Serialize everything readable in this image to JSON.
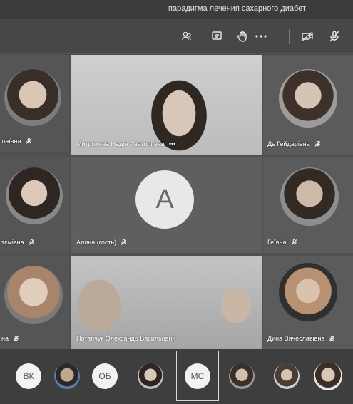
{
  "meeting": {
    "title": "парадигма лечения сахарного диабет"
  },
  "toolbar": {
    "icons": [
      "participants-icon",
      "chat-icon",
      "raise-hand-icon",
      "more-icon",
      "camera-off-icon",
      "mic-off-icon"
    ]
  },
  "participants": {
    "tiles": [
      {
        "label": "лаївна"
      },
      {
        "label": "Митрохина Надія Анатоліївна"
      },
      {
        "label": "Дь Гейдарівна"
      },
      {
        "label": "тємівна"
      },
      {
        "label": "Алина (гость)",
        "initial": "A"
      },
      {
        "label": "Геївна"
      },
      {
        "label": "на"
      },
      {
        "label": "Потапчук Олександр Васильович"
      },
      {
        "label": "Дина Вячеславівна"
      }
    ],
    "more_indicator": "•••"
  },
  "strip": {
    "chips": [
      "ВК",
      "",
      "ОБ",
      "",
      "МС",
      "",
      "",
      ""
    ]
  },
  "colors": {
    "bg": "#4a4a4a",
    "tile": "#5a5a5a",
    "avatar_bg": "#f2f2f2"
  }
}
